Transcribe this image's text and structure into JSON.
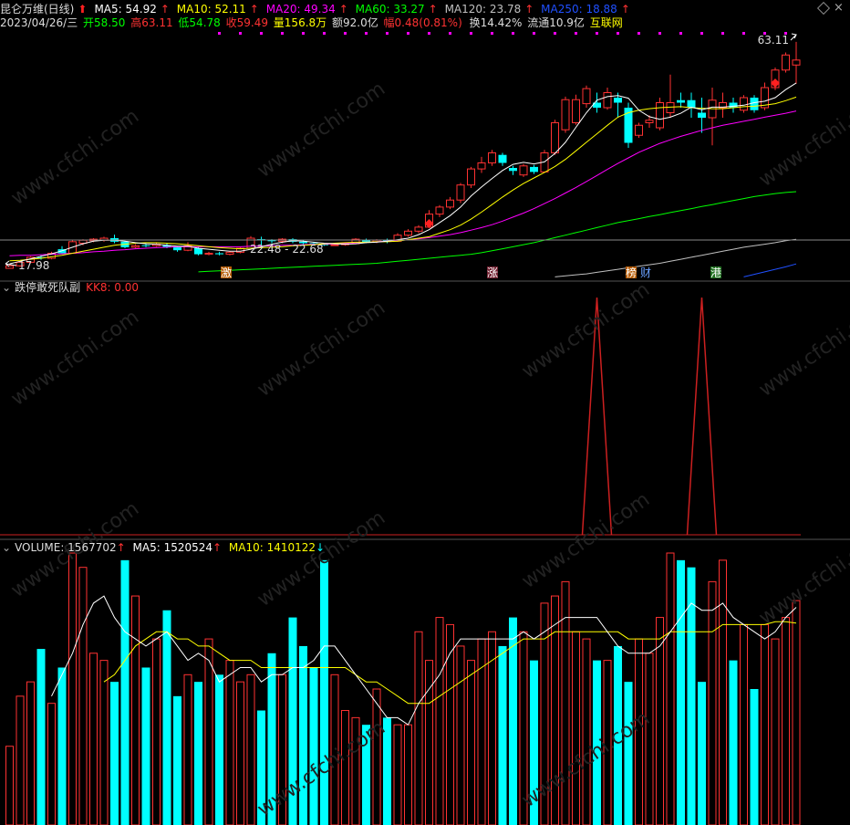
{
  "header": {
    "stock_name": "昆仑万维(日线)",
    "ma5": "MA5: 54.92",
    "ma10": "MA10: 52.11",
    "ma20": "MA20: 49.34",
    "ma60": "MA60: 33.27",
    "ma120": "MA120: 23.78",
    "ma250": "MA250: 18.88",
    "date": "2023/04/26/三",
    "open": "开58.50",
    "high": "高63.11",
    "low": "低54.78",
    "close": "收59.49",
    "volume": "量156.8万",
    "amount": "额92.0亿",
    "change": "幅0.48(0.81%)",
    "turnover": "换14.42%",
    "float": "流通10.9亿",
    "link": "互联网"
  },
  "indicator": {
    "title": "跌停敢死队副",
    "kk8": "KK8: 0.00"
  },
  "volume_panel": {
    "volume": "VOLUME: 1567702",
    "ma5": "MA5: 1520524",
    "ma10": "MA10: 1410122"
  },
  "labels": {
    "high_price": "63.11",
    "low_price": "17.98",
    "range": "22.48 - 22.68",
    "tag1": "激",
    "tag2": "涨",
    "tag3": "榜",
    "tag4": "财",
    "tag5": "港",
    "watermark": "www.cfchi.com"
  },
  "colors": {
    "up": "#ff3232",
    "down": "#00ffff",
    "ma5": "#ffffff",
    "ma10": "#ffff00",
    "ma20": "#ff00ff",
    "ma60": "#00ff00",
    "ma120": "#c0c0c0",
    "ma250": "#2050ff"
  },
  "chart_data": {
    "type": "candlestick",
    "price_range": [
      16,
      66
    ],
    "candles": [
      {
        "o": 18.0,
        "c": 18.5,
        "h": 18.7,
        "l": 17.98
      },
      {
        "o": 18.5,
        "c": 19.2,
        "h": 19.4,
        "l": 18.3
      },
      {
        "o": 19.2,
        "c": 20.2,
        "h": 20.4,
        "l": 19.0
      },
      {
        "o": 20.2,
        "c": 20.0,
        "h": 20.6,
        "l": 19.7
      },
      {
        "o": 20.0,
        "c": 21.0,
        "h": 21.3,
        "l": 19.8
      },
      {
        "o": 21.8,
        "c": 21.0,
        "h": 22.4,
        "l": 20.8
      },
      {
        "o": 21.0,
        "c": 23.3,
        "h": 23.6,
        "l": 20.9
      },
      {
        "o": 23.0,
        "c": 23.6,
        "h": 23.8,
        "l": 22.6
      },
      {
        "o": 23.5,
        "c": 23.8,
        "h": 24.0,
        "l": 23.2
      },
      {
        "o": 23.6,
        "c": 24.0,
        "h": 24.3,
        "l": 23.3
      },
      {
        "o": 24.0,
        "c": 23.3,
        "h": 24.7,
        "l": 23.0
      },
      {
        "o": 23.3,
        "c": 22.2,
        "h": 23.4,
        "l": 22.0
      },
      {
        "o": 22.2,
        "c": 22.5,
        "h": 22.8,
        "l": 22.0
      },
      {
        "o": 22.6,
        "c": 22.5,
        "h": 23.0,
        "l": 22.2
      },
      {
        "o": 22.5,
        "c": 22.8,
        "h": 23.1,
        "l": 22.3
      },
      {
        "o": 22.6,
        "c": 22.2,
        "h": 22.9,
        "l": 22.0
      },
      {
        "o": 22.2,
        "c": 21.6,
        "h": 22.4,
        "l": 21.3
      },
      {
        "o": 21.6,
        "c": 22.5,
        "h": 23.2,
        "l": 21.4
      },
      {
        "o": 22.0,
        "c": 20.8,
        "h": 22.3,
        "l": 20.6
      },
      {
        "o": 20.8,
        "c": 21.0,
        "h": 21.3,
        "l": 20.6
      },
      {
        "o": 21.0,
        "c": 20.8,
        "h": 21.3,
        "l": 20.6
      },
      {
        "o": 20.8,
        "c": 21.2,
        "h": 21.4,
        "l": 20.6
      },
      {
        "o": 21.2,
        "c": 22.0,
        "h": 22.2,
        "l": 21.0
      },
      {
        "o": 22.0,
        "c": 24.0,
        "h": 24.4,
        "l": 21.9
      },
      {
        "o": 23.8,
        "c": 23.6,
        "h": 24.3,
        "l": 22.5
      },
      {
        "o": 23.6,
        "c": 23.4,
        "h": 23.8,
        "l": 23.0
      },
      {
        "o": 23.4,
        "c": 23.8,
        "h": 24.0,
        "l": 23.0
      },
      {
        "o": 23.8,
        "c": 23.3,
        "h": 24.0,
        "l": 23.0
      },
      {
        "o": 23.3,
        "c": 23.0,
        "h": 23.6,
        "l": 22.8
      },
      {
        "o": 23.0,
        "c": 22.8,
        "h": 23.2,
        "l": 22.5
      },
      {
        "o": 22.8,
        "c": 22.6,
        "h": 23.0,
        "l": 22.48
      },
      {
        "o": 22.6,
        "c": 22.7,
        "h": 22.8,
        "l": 22.48
      },
      {
        "o": 22.7,
        "c": 22.9,
        "h": 23.0,
        "l": 22.5
      },
      {
        "o": 22.9,
        "c": 23.8,
        "h": 24.0,
        "l": 22.8
      },
      {
        "o": 23.6,
        "c": 23.3,
        "h": 23.9,
        "l": 23.0
      },
      {
        "o": 23.3,
        "c": 23.6,
        "h": 23.8,
        "l": 23.0
      },
      {
        "o": 23.6,
        "c": 23.4,
        "h": 23.9,
        "l": 23.0
      },
      {
        "o": 23.4,
        "c": 24.6,
        "h": 25.0,
        "l": 23.3
      },
      {
        "o": 24.6,
        "c": 25.4,
        "h": 25.8,
        "l": 24.3
      },
      {
        "o": 25.4,
        "c": 26.2,
        "h": 26.6,
        "l": 25.0
      },
      {
        "o": 26.2,
        "c": 28.8,
        "h": 29.6,
        "l": 26.0
      },
      {
        "o": 28.8,
        "c": 30.2,
        "h": 30.6,
        "l": 28.2
      },
      {
        "o": 30.2,
        "c": 31.6,
        "h": 32.2,
        "l": 29.8
      },
      {
        "o": 31.6,
        "c": 34.6,
        "h": 35.0,
        "l": 31.0
      },
      {
        "o": 34.6,
        "c": 37.8,
        "h": 38.2,
        "l": 34.0
      },
      {
        "o": 37.8,
        "c": 39.0,
        "h": 40.2,
        "l": 37.0
      },
      {
        "o": 39.0,
        "c": 41.0,
        "h": 41.6,
        "l": 38.4
      },
      {
        "o": 40.6,
        "c": 39.0,
        "h": 41.0,
        "l": 38.4
      },
      {
        "o": 38.0,
        "c": 37.4,
        "h": 38.4,
        "l": 36.6
      },
      {
        "o": 36.6,
        "c": 38.4,
        "h": 38.8,
        "l": 36.2
      },
      {
        "o": 38.2,
        "c": 37.2,
        "h": 38.6,
        "l": 36.8
      },
      {
        "o": 37.2,
        "c": 41.0,
        "h": 41.6,
        "l": 37.0
      },
      {
        "o": 41.0,
        "c": 47.0,
        "h": 47.6,
        "l": 40.6
      },
      {
        "o": 45.6,
        "c": 51.6,
        "h": 52.2,
        "l": 45.0
      },
      {
        "o": 47.0,
        "c": 51.6,
        "h": 52.6,
        "l": 46.6
      },
      {
        "o": 50.8,
        "c": 53.8,
        "h": 54.4,
        "l": 50.0
      },
      {
        "o": 51.0,
        "c": 50.0,
        "h": 53.0,
        "l": 49.0
      },
      {
        "o": 50.0,
        "c": 53.0,
        "h": 54.0,
        "l": 49.6
      },
      {
        "o": 52.0,
        "c": 51.0,
        "h": 53.0,
        "l": 48.0
      },
      {
        "o": 50.0,
        "c": 43.0,
        "h": 51.0,
        "l": 42.0
      },
      {
        "o": 44.5,
        "c": 46.5,
        "h": 47.0,
        "l": 44.0
      },
      {
        "o": 47.0,
        "c": 47.5,
        "h": 48.5,
        "l": 46.0
      },
      {
        "o": 46.0,
        "c": 51.0,
        "h": 52.0,
        "l": 45.5
      },
      {
        "o": 49.0,
        "c": 51.0,
        "h": 56.6,
        "l": 48.0
      },
      {
        "o": 51.5,
        "c": 51.0,
        "h": 53.0,
        "l": 50.0
      },
      {
        "o": 51.5,
        "c": 50.0,
        "h": 53.0,
        "l": 48.0
      },
      {
        "o": 49.0,
        "c": 48.0,
        "h": 52.0,
        "l": 45.0
      },
      {
        "o": 48.0,
        "c": 51.5,
        "h": 54.0,
        "l": 42.5
      },
      {
        "o": 50.0,
        "c": 51.0,
        "h": 53.0,
        "l": 48.0
      },
      {
        "o": 51.0,
        "c": 50.0,
        "h": 52.0,
        "l": 49.0
      },
      {
        "o": 49.5,
        "c": 52.0,
        "h": 52.5,
        "l": 49.0
      },
      {
        "o": 52.0,
        "c": 49.5,
        "h": 52.5,
        "l": 49.0
      },
      {
        "o": 50.0,
        "c": 54.0,
        "h": 55.0,
        "l": 49.5
      },
      {
        "o": 54.0,
        "c": 57.5,
        "h": 58.0,
        "l": 53.5
      },
      {
        "o": 57.5,
        "c": 60.5,
        "h": 61.0,
        "l": 57.0
      },
      {
        "o": 58.5,
        "c": 59.49,
        "h": 63.11,
        "l": 54.78
      }
    ],
    "ma5": [
      18.9,
      19.4,
      19.9,
      20.4,
      20.9,
      21.5,
      22.2,
      22.9,
      23.4,
      23.6,
      23.6,
      23.4,
      23.1,
      22.9,
      22.8,
      22.6,
      22.4,
      22.4,
      22.0,
      21.8,
      21.6,
      21.4,
      21.4,
      21.8,
      22.3,
      22.8,
      23.2,
      23.5,
      23.4,
      23.2,
      23.0,
      22.9,
      22.8,
      22.9,
      23.1,
      23.2,
      23.4,
      23.7,
      24.0,
      24.7,
      25.7,
      27.1,
      28.5,
      30.2,
      32.4,
      34.2,
      35.9,
      37.5,
      38.7,
      39.1,
      38.8,
      39.2,
      40.9,
      43.1,
      46.1,
      49.0,
      51.5,
      52.2,
      52.4,
      51.9,
      49.5,
      48.2,
      47.7,
      48.1,
      48.9,
      50.1,
      49.6,
      50.1,
      50.1,
      50.3,
      50.5,
      51.0,
      51.3,
      52.0,
      53.6,
      54.92
    ],
    "ma10": [
      19.5,
      19.6,
      19.8,
      20.0,
      20.3,
      20.6,
      21.0,
      21.4,
      21.8,
      22.2,
      22.6,
      22.8,
      23.0,
      23.1,
      23.1,
      23.0,
      22.9,
      22.7,
      22.5,
      22.3,
      22.1,
      22.0,
      21.9,
      22.0,
      22.1,
      22.2,
      22.3,
      22.5,
      22.6,
      22.7,
      22.9,
      23.0,
      23.1,
      23.2,
      23.2,
      23.3,
      23.3,
      23.4,
      23.7,
      24.0,
      24.3,
      25.0,
      25.7,
      26.6,
      27.8,
      29.2,
      30.7,
      32.2,
      33.6,
      34.9,
      36.0,
      37.1,
      38.3,
      39.7,
      41.4,
      43.1,
      44.8,
      46.5,
      48.1,
      49.0,
      49.5,
      49.8,
      50.0,
      50.1,
      50.2,
      50.0,
      49.9,
      49.8,
      49.8,
      50.0,
      50.2,
      50.3,
      50.5,
      50.8,
      51.4,
      52.11
    ],
    "ma20": [
      20.5,
      20.6,
      20.6,
      20.7,
      20.8,
      20.9,
      21.0,
      21.1,
      21.3,
      21.4,
      21.6,
      21.7,
      21.9,
      22.0,
      22.1,
      22.2,
      22.3,
      22.3,
      22.3,
      22.3,
      22.3,
      22.3,
      22.3,
      22.4,
      22.4,
      22.5,
      22.6,
      22.6,
      22.7,
      22.8,
      22.8,
      22.9,
      23.0,
      23.1,
      23.2,
      23.3,
      23.4,
      23.5,
      23.7,
      23.9,
      24.1,
      24.4,
      24.7,
      25.1,
      25.6,
      26.1,
      26.7,
      27.4,
      28.2,
      29.0,
      29.9,
      30.9,
      31.9,
      33.0,
      34.1,
      35.3,
      36.5,
      37.7,
      38.9,
      40.0,
      41.1,
      42.0,
      42.9,
      43.6,
      44.3,
      44.9,
      45.5,
      46.0,
      46.5,
      46.9,
      47.3,
      47.7,
      48.1,
      48.5,
      48.9,
      49.34
    ],
    "ma60": [
      null,
      null,
      null,
      null,
      null,
      null,
      null,
      null,
      null,
      null,
      null,
      null,
      null,
      null,
      null,
      null,
      null,
      null,
      17.3,
      17.4,
      17.5,
      17.6,
      17.7,
      17.8,
      17.9,
      18.0,
      18.1,
      18.2,
      18.3,
      18.4,
      18.5,
      18.6,
      18.7,
      18.8,
      18.9,
      19.0,
      19.2,
      19.4,
      19.6,
      19.8,
      20.0,
      20.2,
      20.4,
      20.6,
      20.8,
      21.1,
      21.5,
      21.9,
      22.3,
      22.7,
      23.1,
      23.6,
      24.1,
      24.6,
      25.1,
      25.6,
      26.1,
      26.6,
      27.1,
      27.5,
      27.9,
      28.3,
      28.7,
      29.1,
      29.5,
      29.9,
      30.3,
      30.7,
      31.1,
      31.5,
      31.9,
      32.3,
      32.6,
      32.9,
      33.1,
      33.27
    ],
    "ma120": [
      null,
      null,
      null,
      null,
      null,
      null,
      null,
      null,
      null,
      null,
      null,
      null,
      null,
      null,
      null,
      null,
      null,
      null,
      null,
      null,
      null,
      null,
      null,
      null,
      null,
      null,
      null,
      null,
      null,
      null,
      null,
      null,
      null,
      null,
      null,
      null,
      null,
      null,
      null,
      null,
      null,
      null,
      null,
      null,
      null,
      null,
      null,
      null,
      null,
      null,
      null,
      null,
      16.3,
      16.5,
      16.7,
      16.9,
      17.2,
      17.5,
      17.8,
      18.1,
      18.4,
      18.7,
      19.0,
      19.4,
      19.8,
      20.2,
      20.6,
      21.0,
      21.4,
      21.8,
      22.2,
      22.5,
      22.8,
      23.1,
      23.5,
      23.78
    ],
    "ma250": [
      null,
      null,
      null,
      null,
      null,
      null,
      null,
      null,
      null,
      null,
      null,
      null,
      null,
      null,
      null,
      null,
      null,
      null,
      null,
      null,
      null,
      null,
      null,
      null,
      null,
      null,
      null,
      null,
      null,
      null,
      null,
      null,
      null,
      null,
      null,
      null,
      null,
      null,
      null,
      null,
      null,
      null,
      null,
      null,
      null,
      null,
      null,
      null,
      null,
      null,
      null,
      null,
      null,
      null,
      null,
      null,
      null,
      null,
      null,
      null,
      null,
      null,
      null,
      null,
      null,
      null,
      null,
      null,
      null,
      null,
      16.3,
      16.8,
      17.3,
      17.8,
      18.3,
      18.88
    ],
    "kk8_peaks": [
      {
        "i": 56,
        "v": 1
      },
      {
        "i": 66,
        "v": 1
      }
    ],
    "volume_range": [
      0,
      1900000
    ],
    "volume": [
      550000,
      900000,
      1000000,
      1230000,
      850000,
      1100000,
      1900000,
      1800000,
      1200000,
      1150000,
      1000000,
      1850000,
      1600000,
      1100000,
      1300000,
      1500000,
      900000,
      1050000,
      1000000,
      1300000,
      1050000,
      1150000,
      1000000,
      1050000,
      800000,
      1200000,
      1050000,
      1450000,
      1250000,
      1100000,
      1850000,
      1050000,
      800000,
      750000,
      700000,
      950000,
      750000,
      700000,
      700000,
      1350000,
      1150000,
      1450000,
      1400000,
      1250000,
      1150000,
      1300000,
      1350000,
      1250000,
      1450000,
      1350000,
      1150000,
      1550000,
      1600000,
      1700000,
      1350000,
      1300000,
      1150000,
      1150000,
      1250000,
      1000000,
      1300000,
      1200000,
      1450000,
      1900000,
      1850000,
      1800000,
      1000000,
      1700000,
      1850000,
      1150000,
      1400000,
      950000,
      1400000,
      1300000,
      1450000,
      1567702
    ],
    "vol_ma5": [
      null,
      null,
      null,
      null,
      900000,
      1050000,
      1200000,
      1400000,
      1550000,
      1600000,
      1450000,
      1350000,
      1300000,
      1250000,
      1300000,
      1350000,
      1250000,
      1150000,
      1200000,
      1150000,
      1000000,
      1050000,
      1100000,
      1100000,
      1000000,
      1050000,
      1050000,
      1100000,
      1100000,
      1150000,
      1250000,
      1250000,
      1150000,
      1050000,
      950000,
      850000,
      750000,
      750000,
      700000,
      850000,
      950000,
      1050000,
      1200000,
      1300000,
      1300000,
      1300000,
      1300000,
      1300000,
      1300000,
      1350000,
      1300000,
      1350000,
      1400000,
      1450000,
      1450000,
      1450000,
      1450000,
      1350000,
      1250000,
      1200000,
      1200000,
      1200000,
      1250000,
      1350000,
      1450000,
      1550000,
      1500000,
      1500000,
      1550000,
      1450000,
      1400000,
      1350000,
      1300000,
      1350000,
      1450000,
      1520524
    ],
    "vol_ma10": [
      null,
      null,
      null,
      null,
      null,
      null,
      null,
      null,
      null,
      1000000,
      1050000,
      1150000,
      1250000,
      1300000,
      1350000,
      1350000,
      1300000,
      1300000,
      1250000,
      1250000,
      1200000,
      1150000,
      1150000,
      1150000,
      1100000,
      1100000,
      1100000,
      1100000,
      1100000,
      1100000,
      1100000,
      1100000,
      1100000,
      1050000,
      1000000,
      1000000,
      950000,
      900000,
      850000,
      850000,
      850000,
      900000,
      950000,
      1000000,
      1050000,
      1100000,
      1150000,
      1200000,
      1250000,
      1300000,
      1300000,
      1300000,
      1350000,
      1350000,
      1350000,
      1350000,
      1350000,
      1350000,
      1350000,
      1300000,
      1300000,
      1300000,
      1300000,
      1350000,
      1350000,
      1350000,
      1350000,
      1350000,
      1400000,
      1400000,
      1400000,
      1400000,
      1400000,
      1420000,
      1420000,
      1410122
    ]
  }
}
